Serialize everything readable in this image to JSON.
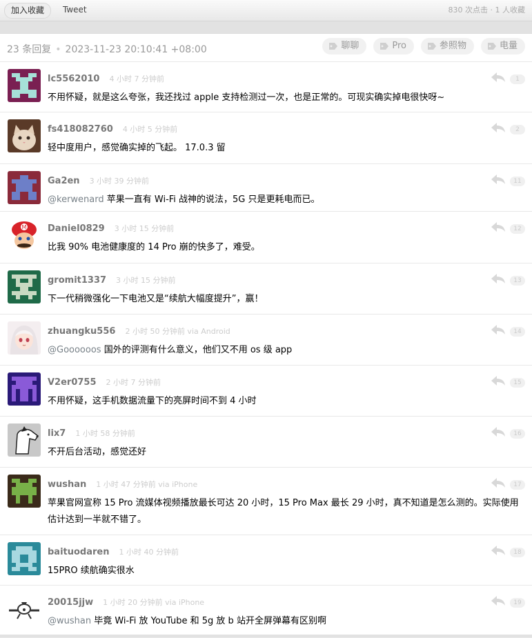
{
  "topbar": {
    "favorite_label": "加入收藏",
    "tweet_label": "Tweet",
    "stats": "830 次点击  ·  1 人收藏"
  },
  "header": {
    "reply_count": "23 条回复",
    "timestamp": "2023-11-23 20:10:41 +08:00",
    "tags": [
      "聊聊",
      "Pro",
      "参照物",
      "电量"
    ]
  },
  "replies": [
    {
      "user": "lc5562010",
      "time": "4 小时 7 分钟前",
      "floor": "1",
      "mention": "",
      "text": "不用怀疑，就是这么夸张，我还找过 apple 支持检测过一次，也是正常的。可现实确实掉电很快呀~",
      "avatar": "pixel-avatar-purple-icon"
    },
    {
      "user": "fs418082760",
      "time": "4 小时 5 分钟前",
      "floor": "2",
      "mention": "",
      "text": "轻中度用户，感觉确实掉的飞起。 17.0.3 留",
      "avatar": "cat-photo-avatar-icon"
    },
    {
      "user": "Ga2en",
      "time": "3 小时 39 分钟前",
      "floor": "11",
      "mention": "@kerwenard",
      "text": " 苹果一直有 Wi-Fi 战神的说法，5G 只是更耗电而已。",
      "avatar": "pixel-avatar-red-blue-icon"
    },
    {
      "user": "Daniel0829",
      "time": "3 小时 15 分钟前",
      "floor": "12",
      "mention": "",
      "text": "比我 90% 电池健康度的 14 Pro 崩的快多了，难受。",
      "avatar": "mario-avatar-icon"
    },
    {
      "user": "gromit1337",
      "time": "3 小时 15 分钟前",
      "floor": "13",
      "mention": "",
      "text": "下一代稍微强化一下电池又是“续航大幅度提升”，赢！",
      "avatar": "pixel-avatar-green-icon"
    },
    {
      "user": "zhuangku556",
      "time": "2 小时 50 分钟前 via Android",
      "floor": "14",
      "mention": "@Goooooos",
      "text": " 国外的评测有什么意义，他们又不用 os 级 app",
      "avatar": "anime-girl-avatar-icon"
    },
    {
      "user": "V2er0755",
      "time": "2 小时 7 分钟前",
      "floor": "15",
      "mention": "",
      "text": "不用怀疑，这手机数据流量下的亮屏时间不到 4 小时",
      "avatar": "pixel-avatar-violet-icon"
    },
    {
      "user": "lix7",
      "time": "1 小时 58 分钟前",
      "floor": "16",
      "mention": "",
      "text": "不开后台活动，感觉还好",
      "avatar": "dog-sketch-avatar-icon"
    },
    {
      "user": "wushan",
      "time": "1 小时 47 分钟前 via iPhone",
      "floor": "17",
      "mention": "",
      "text": "苹果官网宣称 15 Pro 流媒体视频播放最长可达 20 小时，15 Pro Max 最长 29 小时，真不知道是怎么测的。实际使用估计达到一半就不错了。",
      "avatar": "pixel-avatar-olive-icon"
    },
    {
      "user": "baituodaren",
      "time": "1 小时 40 分钟前",
      "floor": "18",
      "mention": "",
      "text": "15PRO 续航确实很水",
      "avatar": "pixel-avatar-teal-icon"
    },
    {
      "user": "20015jjw",
      "time": "1 小时 20 分钟前 via iPhone",
      "floor": "19",
      "mention": "@wushan",
      "text": " 毕竟 Wi-Fi 放 YouTube 和 5g 放 b 站开全屏弹幕有区别啊",
      "avatar": "airplane-avatar-icon"
    }
  ]
}
